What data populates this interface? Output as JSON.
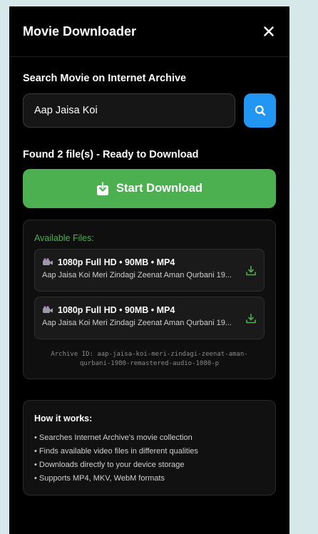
{
  "header": {
    "title": "Movie Downloader"
  },
  "search": {
    "label": "Search Movie on Internet Archive",
    "value": "Aap Jaisa Koi"
  },
  "status": {
    "found_text": "Found 2 file(s) - Ready to Download"
  },
  "download": {
    "label": "Start Download"
  },
  "files": {
    "title": "Available Files:",
    "items": [
      {
        "quality": "1080p Full HD • 90MB • MP4",
        "name": "Aap Jaisa Koi Meri Zindagi Zeenat Aman Qurbani 19..."
      },
      {
        "quality": "1080p Full HD • 90MB • MP4",
        "name": "Aap Jaisa Koi Meri Zindagi Zeenat Aman Qurbani 19..."
      }
    ],
    "archive_line1": "Archive ID: aap-jaisa-koi-meri-zindagi-zeenat-aman-",
    "archive_line2": "qurbani-1980-remastered-audio-1080-p"
  },
  "how": {
    "title": "How it works:",
    "items": [
      "• Searches Internet Archive's movie collection",
      "• Finds available video files in different qualities",
      "• Downloads directly to your device storage",
      "• Supports MP4, MKV, WebM formats"
    ]
  },
  "colors": {
    "accent_green": "#4caf50",
    "accent_blue": "#2196f3",
    "panel_bg": "#000000"
  },
  "icons": {
    "close": "close-icon",
    "search": "search-icon",
    "download": "download-icon",
    "file": "video-camera-icon",
    "file_download": "download-icon"
  }
}
